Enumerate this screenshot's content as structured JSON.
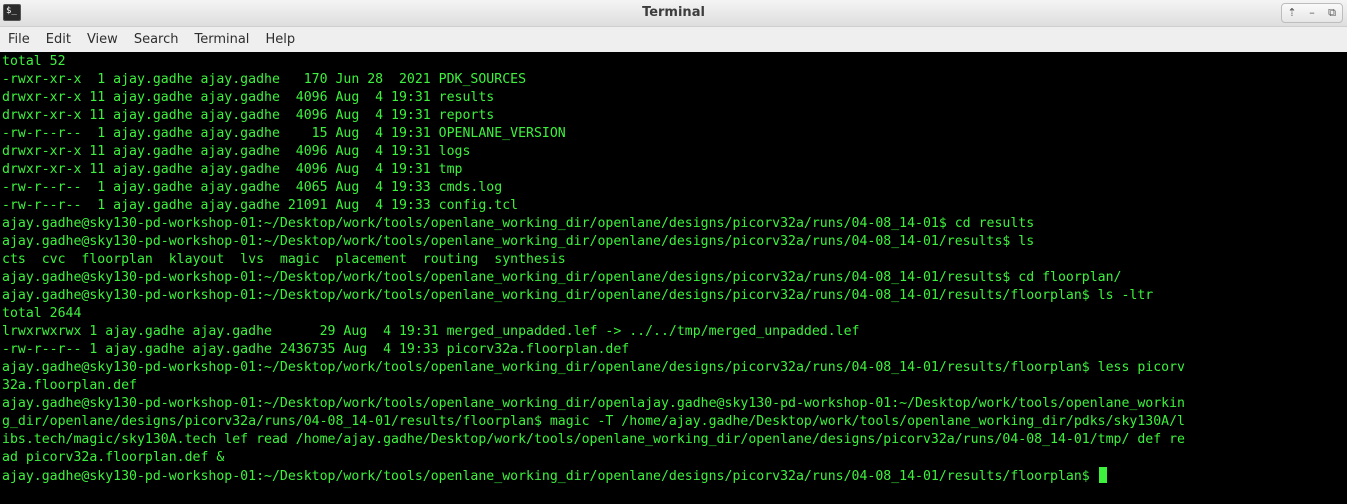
{
  "window": {
    "title": "Terminal",
    "app_icon_glyph": "$_",
    "controls": [
      "⇡",
      "–",
      "⧉"
    ]
  },
  "menu": [
    "File",
    "Edit",
    "View",
    "Search",
    "Terminal",
    "Help"
  ],
  "colors": {
    "text": "#3df23d",
    "background": "#000000"
  },
  "terminal": {
    "lines": [
      "total 52",
      "-rwxr-xr-x  1 ajay.gadhe ajay.gadhe   170 Jun 28  2021 PDK_SOURCES",
      "drwxr-xr-x 11 ajay.gadhe ajay.gadhe  4096 Aug  4 19:31 results",
      "drwxr-xr-x 11 ajay.gadhe ajay.gadhe  4096 Aug  4 19:31 reports",
      "-rw-r--r--  1 ajay.gadhe ajay.gadhe    15 Aug  4 19:31 OPENLANE_VERSION",
      "drwxr-xr-x 11 ajay.gadhe ajay.gadhe  4096 Aug  4 19:31 logs",
      "drwxr-xr-x 11 ajay.gadhe ajay.gadhe  4096 Aug  4 19:31 tmp",
      "-rw-r--r--  1 ajay.gadhe ajay.gadhe  4065 Aug  4 19:33 cmds.log",
      "-rw-r--r--  1 ajay.gadhe ajay.gadhe 21091 Aug  4 19:33 config.tcl",
      "ajay.gadhe@sky130-pd-workshop-01:~/Desktop/work/tools/openlane_working_dir/openlane/designs/picorv32a/runs/04-08_14-01$ cd results",
      "ajay.gadhe@sky130-pd-workshop-01:~/Desktop/work/tools/openlane_working_dir/openlane/designs/picorv32a/runs/04-08_14-01/results$ ls",
      "cts  cvc  floorplan  klayout  lvs  magic  placement  routing  synthesis",
      "ajay.gadhe@sky130-pd-workshop-01:~/Desktop/work/tools/openlane_working_dir/openlane/designs/picorv32a/runs/04-08_14-01/results$ cd floorplan/",
      "ajay.gadhe@sky130-pd-workshop-01:~/Desktop/work/tools/openlane_working_dir/openlane/designs/picorv32a/runs/04-08_14-01/results/floorplan$ ls -ltr",
      "total 2644",
      "lrwxrwxrwx 1 ajay.gadhe ajay.gadhe      29 Aug  4 19:31 merged_unpadded.lef -> ../../tmp/merged_unpadded.lef",
      "-rw-r--r-- 1 ajay.gadhe ajay.gadhe 2436735 Aug  4 19:33 picorv32a.floorplan.def",
      "ajay.gadhe@sky130-pd-workshop-01:~/Desktop/work/tools/openlane_working_dir/openlane/designs/picorv32a/runs/04-08_14-01/results/floorplan$ less picorv",
      "32a.floorplan.def",
      "ajay.gadhe@sky130-pd-workshop-01:~/Desktop/work/tools/openlane_working_dir/openlajay.gadhe@sky130-pd-workshop-01:~/Desktop/work/tools/openlane_workin",
      "g_dir/openlane/designs/picorv32a/runs/04-08_14-01/results/floorplan$ magic -T /home/ajay.gadhe/Desktop/work/tools/openlane_working_dir/pdks/sky130A/l",
      "ibs.tech/magic/sky130A.tech lef read /home/ajay.gadhe/Desktop/work/tools/openlane_working_dir/openlane/designs/picorv32a/runs/04-08_14-01/tmp/ def re",
      "ad picorv32a.floorplan.def &"
    ],
    "prompt": "ajay.gadhe@sky130-pd-workshop-01:~/Desktop/work/tools/openlane_working_dir/openlane/designs/picorv32a/runs/04-08_14-01/results/floorplan$ "
  }
}
